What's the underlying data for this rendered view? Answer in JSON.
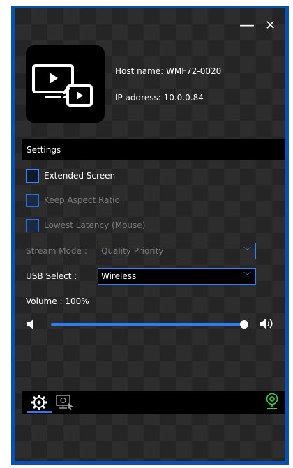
{
  "window": {
    "minimize_glyph": "—",
    "close_glyph": "✕"
  },
  "device": {
    "host_name": "Host name: WMF72-0020",
    "ip_address": "IP address: 10.0.0.84"
  },
  "settings": {
    "header": "Settings",
    "extended_screen": {
      "label": "Extended Screen",
      "checked": false,
      "enabled": true
    },
    "keep_aspect_ratio": {
      "label": "Keep Aspect Ratio",
      "checked": false,
      "enabled": false
    },
    "lowest_latency": {
      "label": "Lowest Latency  (Mouse)",
      "checked": false,
      "enabled": false
    },
    "stream_mode": {
      "label": "Stream Mode :",
      "value": "Quality Priority",
      "enabled": false
    },
    "usb_select": {
      "label": "USB Select :",
      "value": "Wireless",
      "enabled": true
    },
    "volume": {
      "label": "Volume  : 100%",
      "value": 100
    }
  },
  "icons": {
    "cast_logo": "screen-cast-icon",
    "volume_low": "speaker-low-icon",
    "volume_high": "speaker-high-icon",
    "settings_tab": "gear-icon",
    "display_tab": "display-pointer-icon",
    "webcam": "webcam-icon"
  },
  "colors": {
    "accent": "#2e7df0",
    "webcam": "#3ccf4e",
    "frame": "#0a50b4"
  }
}
